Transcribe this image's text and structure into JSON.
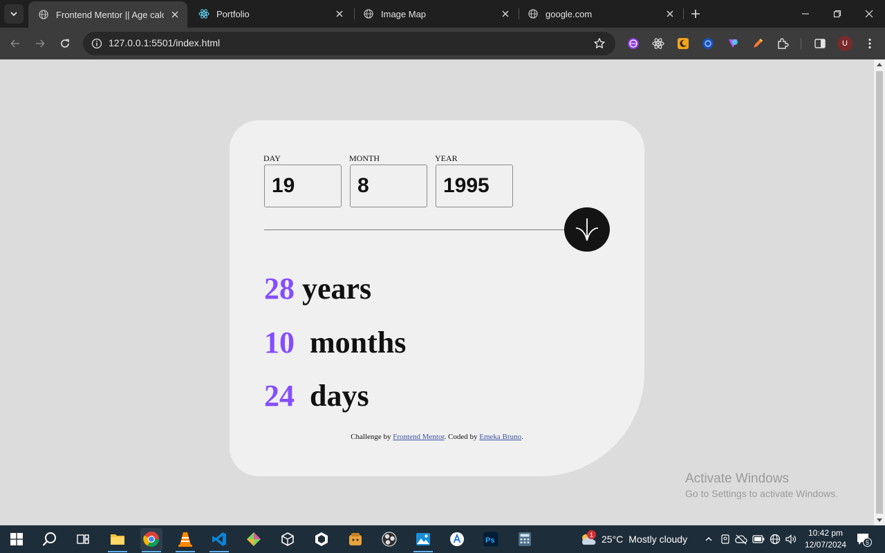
{
  "browser": {
    "tabs": [
      {
        "title": "Frontend Mentor || Age calculator app",
        "active": true,
        "favicon": "globe-icon"
      },
      {
        "title": "Portfolio",
        "active": false,
        "favicon": "react-icon"
      },
      {
        "title": "Image Map",
        "active": false,
        "favicon": "globe-icon"
      },
      {
        "title": "google.com",
        "active": false,
        "favicon": "globe-icon"
      }
    ],
    "url": "127.0.0.1:5501/index.html",
    "profile_initial": "U"
  },
  "app": {
    "fields": [
      {
        "label": "DAY",
        "value": "19"
      },
      {
        "label": "MONTH",
        "value": "8"
      },
      {
        "label": "YEAR",
        "value": "1995"
      }
    ],
    "results": [
      {
        "number": "28",
        "unit": "years"
      },
      {
        "number": "10",
        "unit": "months"
      },
      {
        "number": "24",
        "unit": "days"
      }
    ],
    "attribution": {
      "prefix": "Challenge by",
      "link1": "Frontend Mentor",
      "middle": ". Coded by",
      "link2": "Emeka Bruno",
      "suffix": "."
    },
    "accent_color": "#854dff"
  },
  "watermark": {
    "title": "Activate Windows",
    "subtitle": "Go to Settings to activate Windows."
  },
  "taskbar": {
    "weather_temp": "25°C",
    "weather_desc": "Mostly cloudy",
    "weather_alert": "1",
    "time": "10:42 pm",
    "date": "12/07/2024",
    "notifications": "5"
  }
}
